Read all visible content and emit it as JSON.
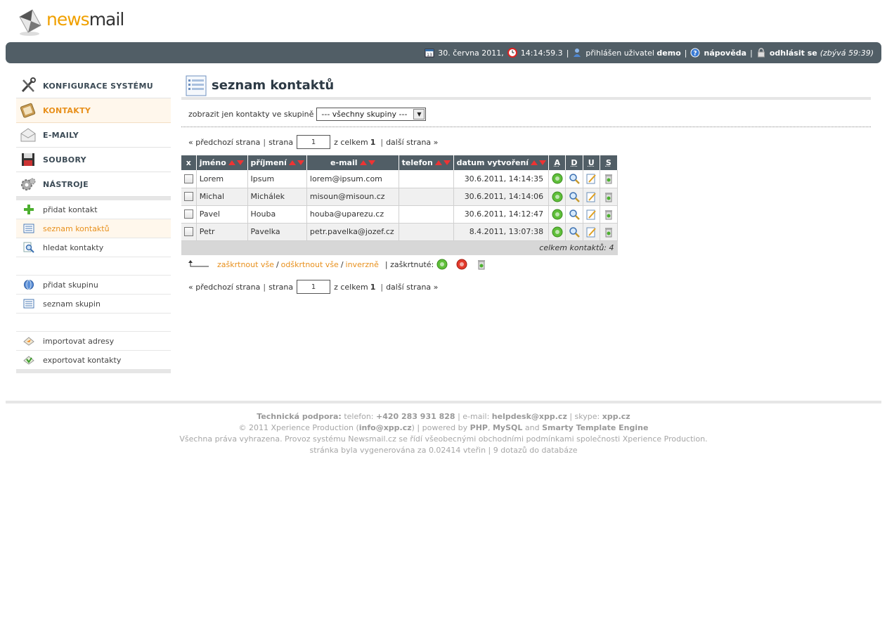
{
  "logo": {
    "part1": "news",
    "part2": "mail"
  },
  "topbar": {
    "date": "30. června 2011,",
    "time": "14:14:59.3",
    "sep": "|",
    "user_prefix": "přihlášen uživatel",
    "user": "demo",
    "help": "nápověda",
    "logout": "odhlásit se",
    "remaining": "(zbývá 59:39)"
  },
  "sidebar": {
    "main": [
      {
        "label": "KONFIGURACE SYSTÉMU",
        "icon": "tools-icon"
      },
      {
        "label": "KONTAKTY",
        "icon": "address-book-icon"
      },
      {
        "label": "E-MAILY",
        "icon": "envelope-icon"
      },
      {
        "label": "SOUBORY",
        "icon": "floppy-disk-icon"
      },
      {
        "label": "NÁSTROJE",
        "icon": "gears-icon"
      }
    ],
    "sub": [
      {
        "label": "přidat kontakt",
        "icon": "plus-icon"
      },
      {
        "label": "seznam kontaktů",
        "icon": "list-icon"
      },
      {
        "label": "hledat kontakty",
        "icon": "magnifier-icon"
      },
      {
        "label": "přidat skupinu",
        "icon": "globe-icon"
      },
      {
        "label": "seznam skupin",
        "icon": "list-icon"
      },
      {
        "label": "importovat adresy",
        "icon": "import-icon"
      },
      {
        "label": "exportovat kontakty",
        "icon": "export-icon"
      }
    ]
  },
  "main": {
    "title": "seznam kontaktů",
    "filter_label": "zobrazit jen kontakty ve skupině",
    "filter_value": "--- všechny skupiny ---",
    "pager": {
      "prev": "« předchozí strana",
      "page_label": "strana",
      "page_value": "1",
      "total_label": "z celkem",
      "total_value": "1",
      "next": "další strana »",
      "sep": "|"
    },
    "columns": {
      "x": "x",
      "jmeno": "jméno",
      "prijmeni": "příjmení",
      "email": "e-mail",
      "telefon": "telefon",
      "datum": "datum vytvoření",
      "a": "A",
      "d": "D",
      "u": "U",
      "s": "S"
    },
    "rows": [
      {
        "jmeno": "Lorem",
        "prijmeni": "Ipsum",
        "email": "lorem@ipsum.com",
        "telefon": "",
        "datum": "30.6.2011, 14:14:35"
      },
      {
        "jmeno": "Michal",
        "prijmeni": "Michálek",
        "email": "misoun@misoun.cz",
        "telefon": "",
        "datum": "30.6.2011, 14:14:06"
      },
      {
        "jmeno": "Pavel",
        "prijmeni": "Houba",
        "email": "houba@uparezu.cz",
        "telefon": "",
        "datum": "30.6.2011, 14:12:47"
      },
      {
        "jmeno": "Petr",
        "prijmeni": "Pavelka",
        "email": "petr.pavelka@jozef.cz",
        "telefon": "",
        "datum": "8.4.2011, 13:07:38"
      }
    ],
    "total": "celkem kontaktů: 4",
    "bulk": {
      "check_all": "zaškrtnout vše",
      "uncheck_all": "odškrtnout vše",
      "invert": "inverzně",
      "slash": "/",
      "checked_label": "| zaškrtnuté:"
    }
  },
  "footer": {
    "support_label": "Technická podpora:",
    "phone_label": "telefon:",
    "phone": "+420 283 931 828",
    "email_label": "| e-mail:",
    "email": "helpdesk@xpp.cz",
    "skype_label": "| skype:",
    "skype": "xpp.cz",
    "copyright": "© 2011 Xperience Production (",
    "copyright_email": "info@xpp.cz",
    "powered": ") | powered by",
    "php": "PHP",
    "comma": ",",
    "mysql": "MySQL",
    "and": "and",
    "smarty": "Smarty Template Engine",
    "rights": "Všechna práva vyhrazena. Provoz systému Newsmail.cz se řídí všeobecnými obchodními podmínkami společnosti Xperience Production.",
    "generated": "stránka byla vygenerována za 0.02414 vteřin | 9 dotazů do databáze"
  }
}
